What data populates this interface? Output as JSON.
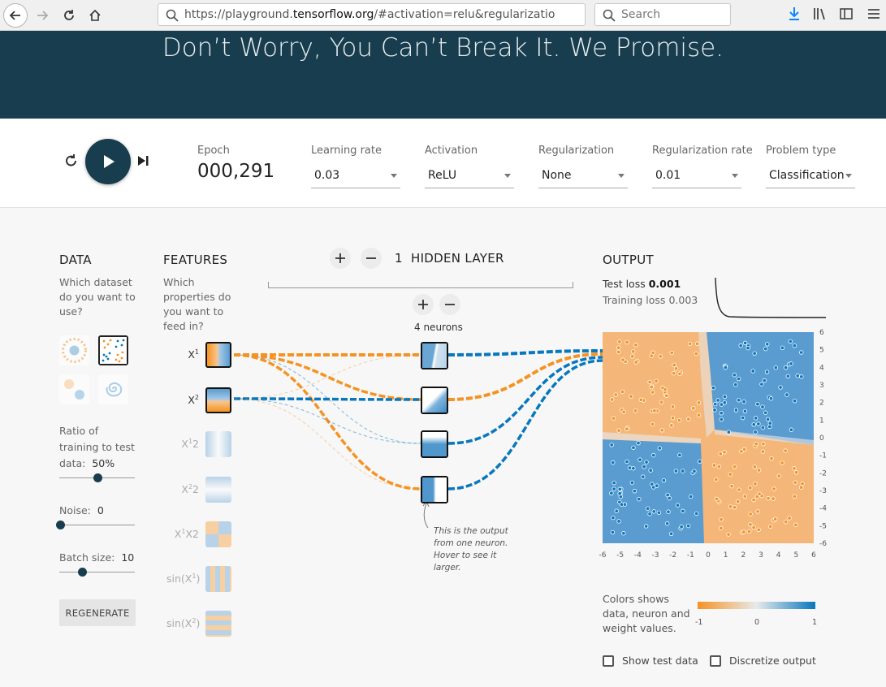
{
  "browser": {
    "url_prefix": "https://playground.",
    "url_domain": "tensorflow.org",
    "url_suffix": "/#activation=relu&regularizatio",
    "search_placeholder": "Search"
  },
  "hero": {
    "title": "Don’t Worry, You Can’t Break It. We Promise."
  },
  "controls": {
    "epoch_label": "Epoch",
    "epoch_value": "000,291",
    "learning_rate": {
      "label": "Learning rate",
      "value": "0.03"
    },
    "activation": {
      "label": "Activation",
      "value": "ReLU"
    },
    "regularization": {
      "label": "Regularization",
      "value": "None"
    },
    "regularization_rate": {
      "label": "Regularization rate",
      "value": "0.01"
    },
    "problem_type": {
      "label": "Problem type",
      "value": "Classification"
    }
  },
  "data_panel": {
    "title": "DATA",
    "question": "Which dataset do you want to use?",
    "ratio_label": "Ratio of training to test data:",
    "ratio_value": "50%",
    "ratio": 0.5,
    "noise_label": "Noise:",
    "noise_value": "0",
    "noise": 0,
    "batch_label": "Batch size:",
    "batch_value": "10",
    "batch": 10,
    "regenerate": "REGENERATE"
  },
  "features_panel": {
    "title": "FEATURES",
    "question": "Which properties do you want to feed in?",
    "features": [
      {
        "base": "X",
        "sup": "1",
        "tail": "",
        "active": true
      },
      {
        "base": "X",
        "sup": "2",
        "tail": "",
        "active": true
      },
      {
        "base": "X",
        "sup": "1",
        "tail": "2",
        "active": false
      },
      {
        "base": "X",
        "sup": "2",
        "tail": "2",
        "active": false
      },
      {
        "base": "X",
        "sup": "1",
        "tail": "X2",
        "active": false
      },
      {
        "base": "sin(X",
        "sup": "1",
        "tail": ")",
        "active": false
      },
      {
        "base": "sin(X",
        "sup": "2",
        "tail": ")",
        "active": false
      }
    ]
  },
  "network": {
    "layer_count": "1",
    "layer_title": "HIDDEN LAYER",
    "neurons_label": "4 neurons",
    "note": "This is the output from one neuron. Hover to see it larger."
  },
  "output_panel": {
    "title": "OUTPUT",
    "test_loss_label": "Test loss",
    "test_loss_value": "0.001",
    "training_loss_label": "Training loss",
    "training_loss_value": "0.003",
    "axis_ticks": [
      "-6",
      "-5",
      "-4",
      "-3",
      "-2",
      "-1",
      "0",
      "1",
      "2",
      "3",
      "4",
      "5",
      "6"
    ],
    "legend_desc": "Colors shows data, neuron and weight values.",
    "legend_ticks": [
      "-1",
      "0",
      "1"
    ],
    "show_test_data": "Show test data",
    "discretize_output": "Discretize output"
  },
  "colors": {
    "orange": "#f59322",
    "blue": "#0877bd",
    "dark": "#183d4e"
  }
}
